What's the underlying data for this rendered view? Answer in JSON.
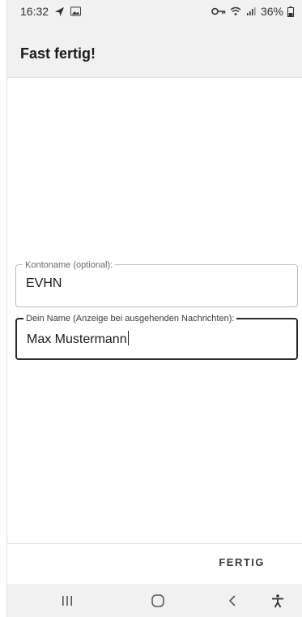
{
  "status": {
    "time": "16:32",
    "battery": "36%",
    "icons_left": [
      "send-icon",
      "image-icon"
    ],
    "icons_right": [
      "key-icon",
      "wifi-icon",
      "signal-icon",
      "battery-icon"
    ]
  },
  "app_bar": {
    "title": "Fast fertig!"
  },
  "form": {
    "account_name": {
      "label": "Kontoname (optional):",
      "value": "EVHN"
    },
    "your_name": {
      "label": "Dein Name (Anzeige bei ausgehenden Nachrichten):",
      "value": "Max Mustermann"
    }
  },
  "actions": {
    "done_label": "FERTIG"
  },
  "navbar": {
    "icons": [
      "recent-apps-icon",
      "home-icon",
      "back-icon",
      "accessibility-icon"
    ]
  },
  "colors": {
    "bar_background": "#f1f1f1",
    "field_focus_border": "#2b2b2b",
    "field_border": "#b9b9b9"
  }
}
